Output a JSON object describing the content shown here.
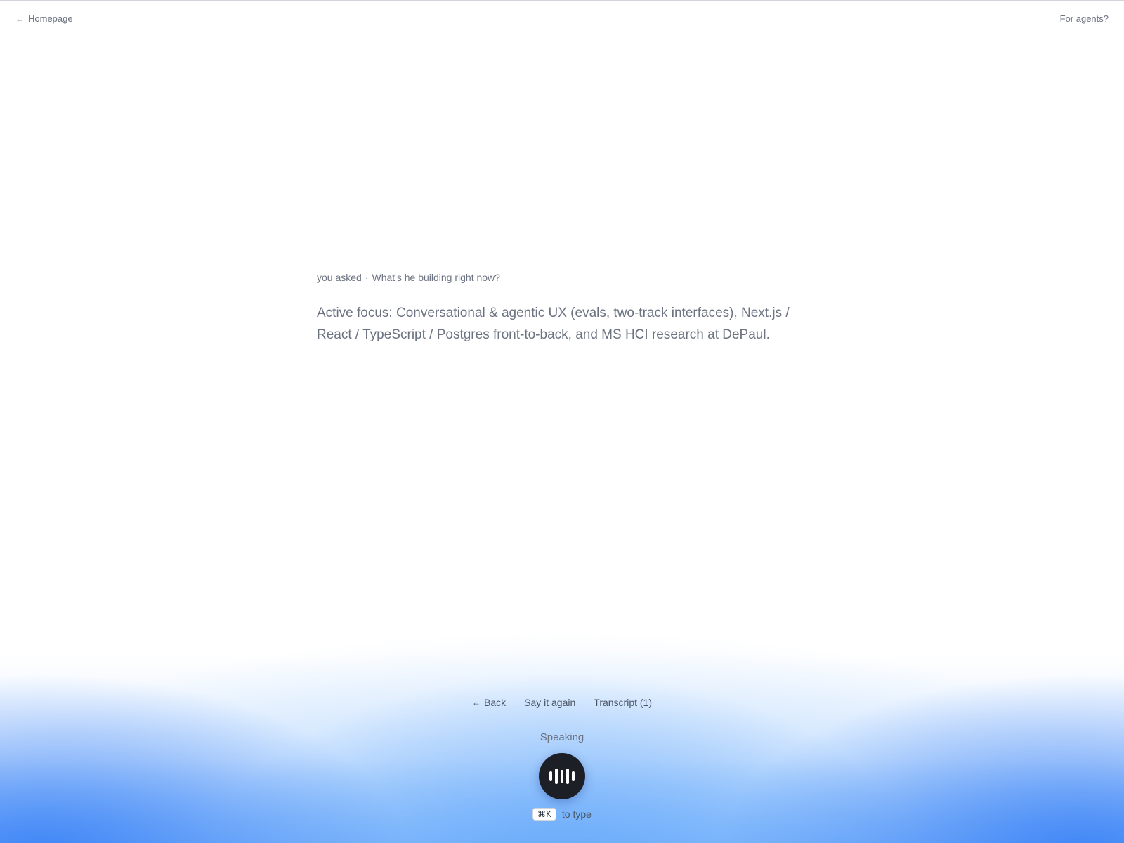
{
  "nav": {
    "home_label": "Homepage",
    "agents_label": "For agents?"
  },
  "conversation": {
    "asked_prefix": "you asked",
    "separator": "·",
    "question": "What's he building right now?",
    "answer": "Active focus: Conversational & agentic UX (evals, two-track interfaces), Next.js / React / TypeScript / Postgres front-to-back, and MS HCI research at DePaul."
  },
  "controls": {
    "back_label": "Back",
    "say_again_label": "Say it again",
    "transcript_label": "Transcript (1)"
  },
  "voice": {
    "status": "Speaking",
    "button_icon": "waveform-icon"
  },
  "hint": {
    "shortcut": "⌘K",
    "text": "to type"
  },
  "icons": {
    "home_arrow": "arrow-left-icon",
    "back_arrow": "arrow-left-icon"
  },
  "colors": {
    "accent": "#3b82f6",
    "mic_button": "#1c1f26",
    "text_muted": "#6b7280"
  }
}
